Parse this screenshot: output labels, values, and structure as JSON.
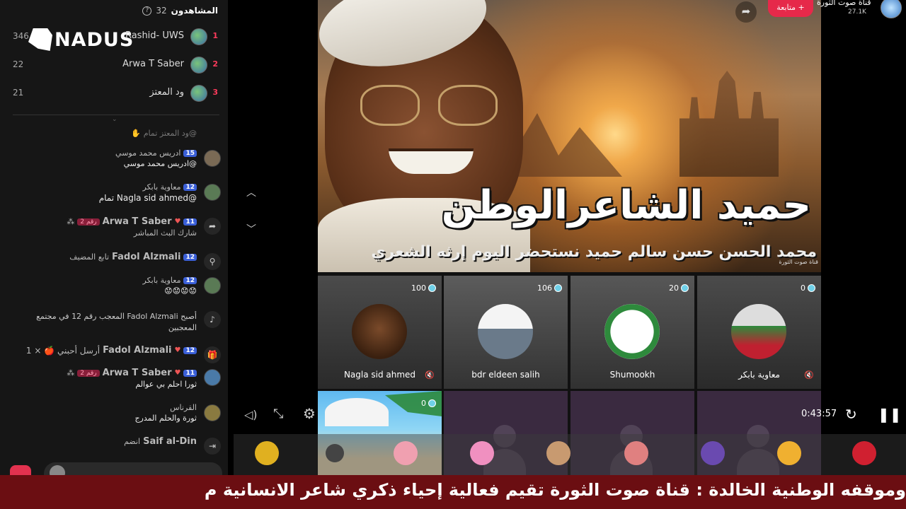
{
  "viewers": {
    "label": "المشاهدون",
    "count": "32"
  },
  "logo_text": "NADUS",
  "ranking": [
    {
      "score": "346",
      "name": "Rashid- UWS",
      "num": "1"
    },
    {
      "score": "22",
      "name": "Arwa T Saber",
      "num": "2"
    },
    {
      "score": "21",
      "name": "ود المعتز",
      "num": "3"
    }
  ],
  "chat": [
    {
      "user": "@ود المعتز تمام",
      "text": ""
    },
    {
      "user": "ادريس محمد موسي",
      "level": "15",
      "text": "@ادريس محمد موسي"
    },
    {
      "user": "معاوية بابكر",
      "level": "12",
      "text": "@Nagla sid ahmed تمام"
    },
    {
      "user": "Arwa T Saber",
      "level": "11",
      "rank": "رقم 2",
      "text": "شارك البث المباشر"
    },
    {
      "user": "Fadol Alzmali",
      "level": "12",
      "text": "تابع المضيف"
    },
    {
      "user": "معاوية بابكر",
      "level": "12",
      "text": "😟😟😟😟"
    },
    {
      "user": "Fadol Alzmali",
      "text": "أصبح Fadol Alzmali المعجب رقم 12 في مجتمع المعجبين"
    },
    {
      "user": "Fadol Alzmali",
      "level": "12",
      "text": "أرسل أحبني 🍎 × 1"
    },
    {
      "user": "Arwa T Saber",
      "level": "11",
      "rank": "رقم 2",
      "text": "ثورا احلم بي عوالم"
    },
    {
      "user": "القرناس",
      "text": "ثورة والحلم المدرج"
    },
    {
      "user": "Saif al-Din",
      "text": "انضم"
    }
  ],
  "hero": {
    "title": "حميد الشاعرالوطن",
    "subtitle": "محمد الحسن حسن سالم حميد      نستحضر اليوم إرثه الشعري",
    "watermark": "قناة صوت الثورة",
    "follow": "+ متابعة"
  },
  "tiles": [
    {
      "name": "Nagla sid ahmed",
      "coins": "100"
    },
    {
      "name": "bdr eldeen salih",
      "coins": "106"
    },
    {
      "name": "Shumookh",
      "coins": "20"
    },
    {
      "name": "معاوية بابكر",
      "coins": "0"
    },
    {
      "name": "",
      "coins": "0"
    }
  ],
  "player": {
    "time": "0:43:57"
  },
  "channel": {
    "name": "قناة صوت الثورة",
    "likes": "27.1K"
  },
  "ticker": "وموقفه الوطنية الخالدة :      قناة صوت الثورة تقيم فعالية إحياء ذكري شاعر الانسانية م"
}
